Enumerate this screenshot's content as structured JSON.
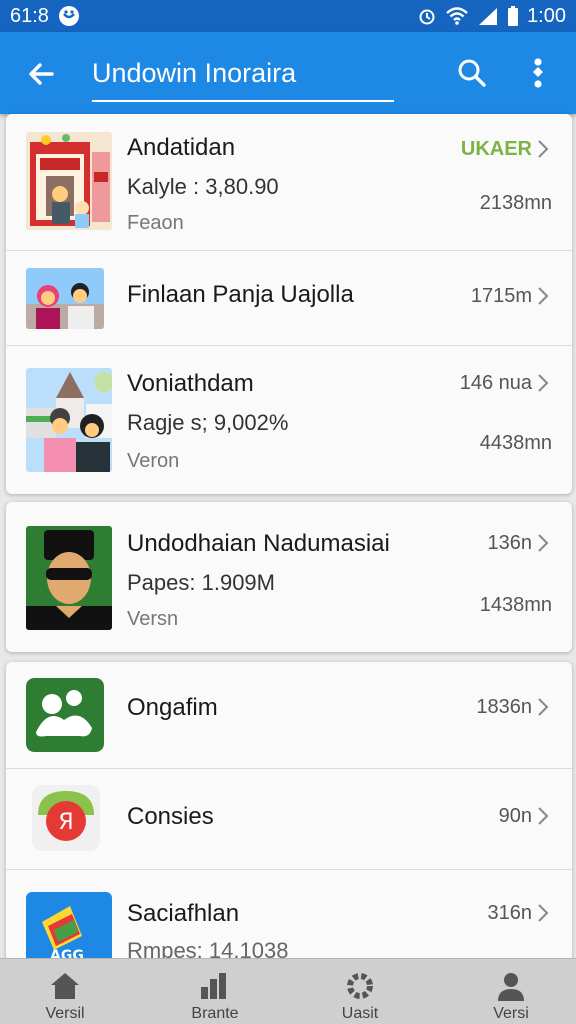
{
  "status_bar": {
    "left_text": "61:8",
    "time": "1:00"
  },
  "app_bar": {
    "title": "Undowin Inoraira",
    "back_icon": "arrow-left-icon",
    "search_icon": "search-icon",
    "more_icon": "more-vertical-icon"
  },
  "lists": {
    "card1": [
      {
        "title": "Andatidan",
        "meta": "Kalyle : 3,80.90",
        "sub": "Feaon",
        "right_top": "UKAER",
        "right_bottom": "2138mn"
      },
      {
        "title": "Finlaan Panja Uajolla",
        "right_top": "1715m"
      },
      {
        "title": "Voniathdam",
        "meta": "Ragje s; 9,002%",
        "sub": "Veron",
        "right_top": "146 nua",
        "right_bottom": "4438mn"
      }
    ],
    "card2": [
      {
        "title": "Undodhaian Nadumasiai",
        "meta": "Papes: 1.909M",
        "sub": "Versn",
        "right_top": "136n",
        "right_bottom": "1438mn"
      }
    ],
    "card3": [
      {
        "title": "Ongafim",
        "right_top": "1836n"
      },
      {
        "title": "Consies",
        "right_top": "90n"
      },
      {
        "title": "Saciafhlan",
        "meta": "Rmpes: 14,1038",
        "right_top": "316n"
      }
    ]
  },
  "bottom_nav": [
    {
      "label": "Versil",
      "icon": "home-icon"
    },
    {
      "label": "Brante",
      "icon": "bar-chart-icon"
    },
    {
      "label": "Uasit",
      "icon": "settings-icon"
    },
    {
      "label": "Versi",
      "icon": "person-icon"
    }
  ],
  "colors": {
    "status_bar": "#1565c0",
    "app_bar": "#1e88e5",
    "accent_green": "#7cb342"
  }
}
